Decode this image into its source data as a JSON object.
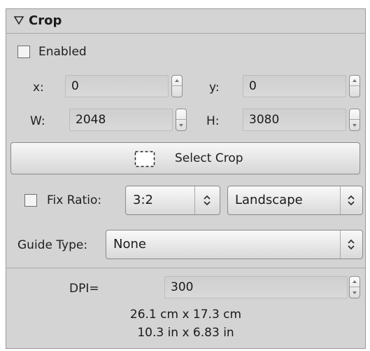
{
  "header": {
    "title": "Crop"
  },
  "enabled": {
    "label": "Enabled",
    "checked": false
  },
  "coords": {
    "x_label": "x:",
    "x_value": "0",
    "y_label": "y:",
    "y_value": "0",
    "w_label": "W:",
    "w_value": "2048",
    "h_label": "H:",
    "h_value": "3080"
  },
  "select_crop": {
    "label": "Select Crop"
  },
  "fix_ratio": {
    "label": "Fix Ratio:",
    "checked": false,
    "ratio_selected": "3:2",
    "orientation_selected": "Landscape"
  },
  "guide_type": {
    "label": "Guide Type:",
    "selected": "None"
  },
  "dpi": {
    "label": "DPI=",
    "value": "300"
  },
  "size_info": {
    "metric": "26.1 cm x 17.3 cm",
    "imperial": "10.3 in x 6.83 in"
  },
  "icons": {
    "collapse": "triangle-down-icon",
    "select_crop": "dashed-rectangle-icon",
    "spinner": "spin-up-down-icon",
    "combo": "up-down-chevron-icon"
  }
}
